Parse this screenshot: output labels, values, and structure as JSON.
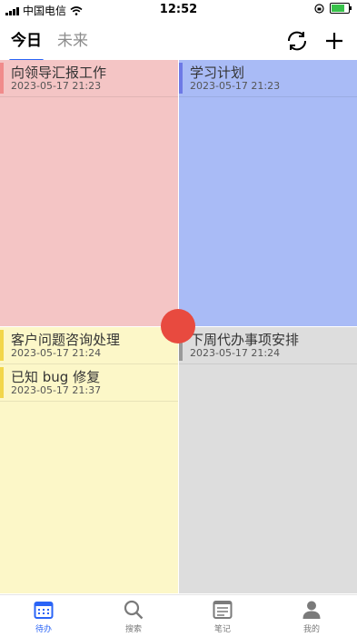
{
  "status": {
    "carrier": "中国电信",
    "time": "12:52"
  },
  "header": {
    "tabs": [
      {
        "label": "今日",
        "active": true
      },
      {
        "label": "未来",
        "active": false
      }
    ],
    "icons": [
      "refresh-icon",
      "plus-icon"
    ]
  },
  "quadrants": {
    "q1": {
      "color": "#f4c5c5",
      "accent": "#f08b8b",
      "tasks": [
        {
          "title": "向领导汇报工作",
          "date": "2023-05-17 21:23"
        }
      ]
    },
    "q2": {
      "color": "#a9bbf6",
      "accent": "#6d79e6",
      "tasks": [
        {
          "title": "学习计划",
          "date": "2023-05-17 21:23"
        }
      ]
    },
    "q3": {
      "color": "#fcf7c8",
      "accent": "#f2d64a",
      "tasks": [
        {
          "title": "客户问题咨询处理",
          "date": "2023-05-17 21:24"
        },
        {
          "title": "已知 bug 修复",
          "date": "2023-05-17 21:37"
        }
      ]
    },
    "q4": {
      "color": "#dddddd",
      "accent": "#9a9a9a",
      "tasks": [
        {
          "title": "下周代办事项安排",
          "date": "2023-05-17 21:24"
        }
      ]
    }
  },
  "fab": {
    "color": "#e84a3f"
  },
  "bottom_nav": [
    {
      "label": "待办",
      "icon": "calendar-icon",
      "active": true
    },
    {
      "label": "搜索",
      "icon": "search-icon",
      "active": false
    },
    {
      "label": "笔记",
      "icon": "notes-icon",
      "active": false
    },
    {
      "label": "我的",
      "icon": "person-icon",
      "active": false
    }
  ]
}
